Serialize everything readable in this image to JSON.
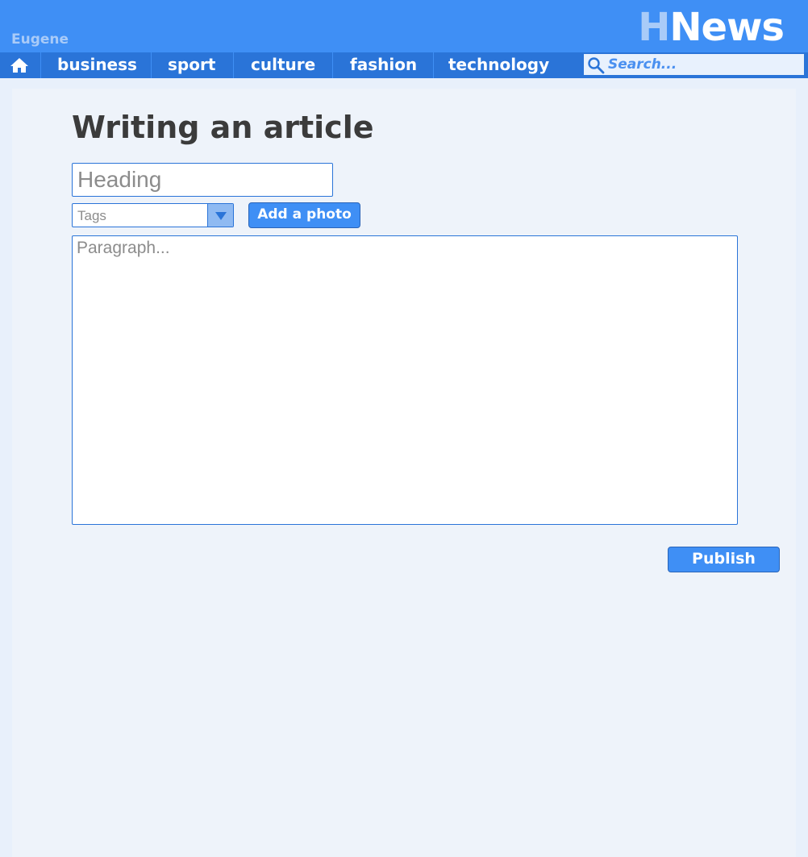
{
  "header": {
    "user_name": "Eugene",
    "logo_prefix": "H",
    "logo_rest": "News"
  },
  "nav": {
    "home_icon": "home-icon",
    "items": [
      {
        "label": "business"
      },
      {
        "label": "sport"
      },
      {
        "label": "culture"
      },
      {
        "label": "fashion"
      },
      {
        "label": "technology"
      }
    ],
    "search": {
      "placeholder": "Search...",
      "icon": "search-icon"
    }
  },
  "main": {
    "title": "Writing an article",
    "heading_placeholder": "Heading",
    "tags_label": "Tags",
    "add_photo_label": "Add a photo",
    "paragraph_placeholder": "Paragraph...",
    "publish_label": "Publish"
  },
  "colors": {
    "header_bg": "#3f8ff5",
    "nav_bg": "#2a74d8",
    "page_bg": "#eef3fa",
    "accent": "#3f8ff5",
    "logo_light": "#a9cbf8",
    "title_text": "#3b3b3b"
  }
}
